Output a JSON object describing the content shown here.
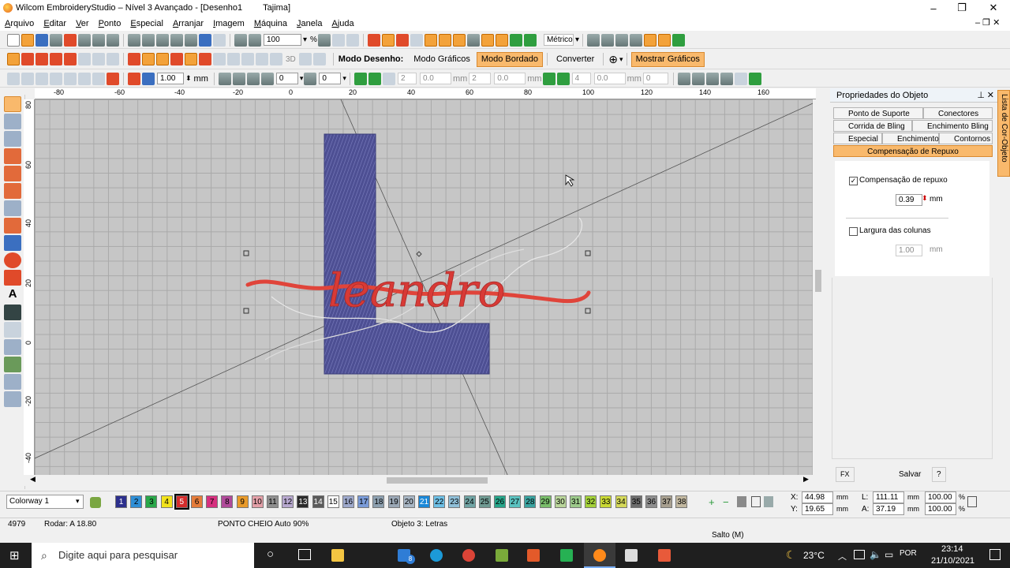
{
  "title": {
    "app": "Wilcom EmbroideryStudio – Nível 3 Avançado - [Desenho1",
    "machine": "Tajima]"
  },
  "menu": [
    "Arquivo",
    "Editar",
    "Ver",
    "Ponto",
    "Especial",
    "Arranjar",
    "Imagem",
    "Máquina",
    "Janela",
    "Ajuda"
  ],
  "toolbar1": {
    "zoom": "100",
    "units": "Métrico",
    "percent": "%"
  },
  "toolbar2": {
    "mode_label": "Modo Desenho:",
    "graphics_mode": "Modo Gráficos",
    "embroidery_mode": "Modo Bordado",
    "convert": "Converter",
    "show_graphics": "Mostrar Gráficos",
    "three_d": "3D"
  },
  "toolbar3": {
    "value1": "1.00",
    "unit1": "mm",
    "value2": "0",
    "value3": "0",
    "value4": "2",
    "value5": "0.0",
    "unit5": "mm",
    "value6": "2",
    "value7": "0.0",
    "unit7": "mm",
    "value8": "4",
    "value9": "0.0",
    "unit9": "mm",
    "value10": "0"
  },
  "ruler": {
    "h": [
      "-80",
      "-60",
      "-40",
      "-20",
      "0",
      "20",
      "40",
      "60",
      "80",
      "100",
      "120",
      "140",
      "160"
    ],
    "v": [
      "80",
      "60",
      "40",
      "20",
      "0",
      "-20",
      "-40"
    ]
  },
  "design": {
    "word": "leandro",
    "letter": "L"
  },
  "panel": {
    "title": "Propriedades do Objeto",
    "tabs": [
      "Ponto de Suporte",
      "Conectores",
      "Corrida de Bling",
      "Enchimento Bling",
      "Especial",
      "Enchimentos",
      "Contornos",
      "Compensação de Repuxo"
    ],
    "comp_label": "Compensação de repuxo",
    "comp_value": "0.39",
    "comp_unit": "mm",
    "col_label": "Largura das colunas",
    "col_value": "1.00",
    "col_unit": "mm",
    "fx": "FX",
    "save": "Salvar",
    "help": "?"
  },
  "sidetab": "Lista de Cor-Objeto",
  "palette": {
    "colorway": "Colorway 1",
    "swatches": [
      {
        "n": "1",
        "c": "#2c2f8c"
      },
      {
        "n": "2",
        "c": "#2f8fd6"
      },
      {
        "n": "3",
        "c": "#2aa84a"
      },
      {
        "n": "4",
        "c": "#f2e21b"
      },
      {
        "n": "5",
        "c": "#d52c2c"
      },
      {
        "n": "6",
        "c": "#e57c3a"
      },
      {
        "n": "7",
        "c": "#d6307f"
      },
      {
        "n": "8",
        "c": "#b04a9a"
      },
      {
        "n": "9",
        "c": "#e89a2a"
      },
      {
        "n": "10",
        "c": "#e3a0a8"
      },
      {
        "n": "11",
        "c": "#8f8f8f"
      },
      {
        "n": "12",
        "c": "#b7a8cf"
      },
      {
        "n": "13",
        "c": "#2a2a2a"
      },
      {
        "n": "14",
        "c": "#5b5b5b"
      },
      {
        "n": "15",
        "c": "#ffffff"
      },
      {
        "n": "16",
        "c": "#9ea9cc"
      },
      {
        "n": "17",
        "c": "#7a9bd8"
      },
      {
        "n": "18",
        "c": "#8da0b0"
      },
      {
        "n": "19",
        "c": "#9aa7b5"
      },
      {
        "n": "20",
        "c": "#a8b6c4"
      },
      {
        "n": "21",
        "c": "#1a88d8"
      },
      {
        "n": "22",
        "c": "#6ec0e6"
      },
      {
        "n": "23",
        "c": "#8fbfd8"
      },
      {
        "n": "24",
        "c": "#6fa3a3"
      },
      {
        "n": "25",
        "c": "#6f9a92"
      },
      {
        "n": "26",
        "c": "#27a58a"
      },
      {
        "n": "27",
        "c": "#5ac2c0"
      },
      {
        "n": "28",
        "c": "#3aa3a0"
      },
      {
        "n": "29",
        "c": "#79bd6a"
      },
      {
        "n": "30",
        "c": "#b9d59a"
      },
      {
        "n": "31",
        "c": "#9cc98a"
      },
      {
        "n": "32",
        "c": "#a4d23a"
      },
      {
        "n": "33",
        "c": "#c9d834"
      },
      {
        "n": "34",
        "c": "#d4d85a"
      },
      {
        "n": "35",
        "c": "#6d6d6d"
      },
      {
        "n": "36",
        "c": "#8e8e8e"
      },
      {
        "n": "37",
        "c": "#a8a090"
      },
      {
        "n": "38",
        "c": "#c2b8a0"
      }
    ]
  },
  "coords": {
    "x_label": "X:",
    "x": "44.98",
    "x_unit": "mm",
    "y_label": "Y:",
    "y": "19.65",
    "y_unit": "mm",
    "l_label": "L:",
    "l": "111.11",
    "l_unit": "mm",
    "a_label": "A:",
    "a": "37.19",
    "a_unit": "mm",
    "lp": "100.00",
    "ap": "100.00",
    "pct": "%"
  },
  "status": {
    "stitches": "4979",
    "rotate": "Rodar: A  18.80",
    "stitch_type": "PONTO CHEIO Auto 90%",
    "object": "Objeto 3: Letras",
    "jump": "Salto (M)"
  },
  "taskbar": {
    "search": "Digite aqui para pesquisar",
    "temp": "23°C",
    "time": "23:14",
    "date": "21/10/2021",
    "badge": "8"
  }
}
